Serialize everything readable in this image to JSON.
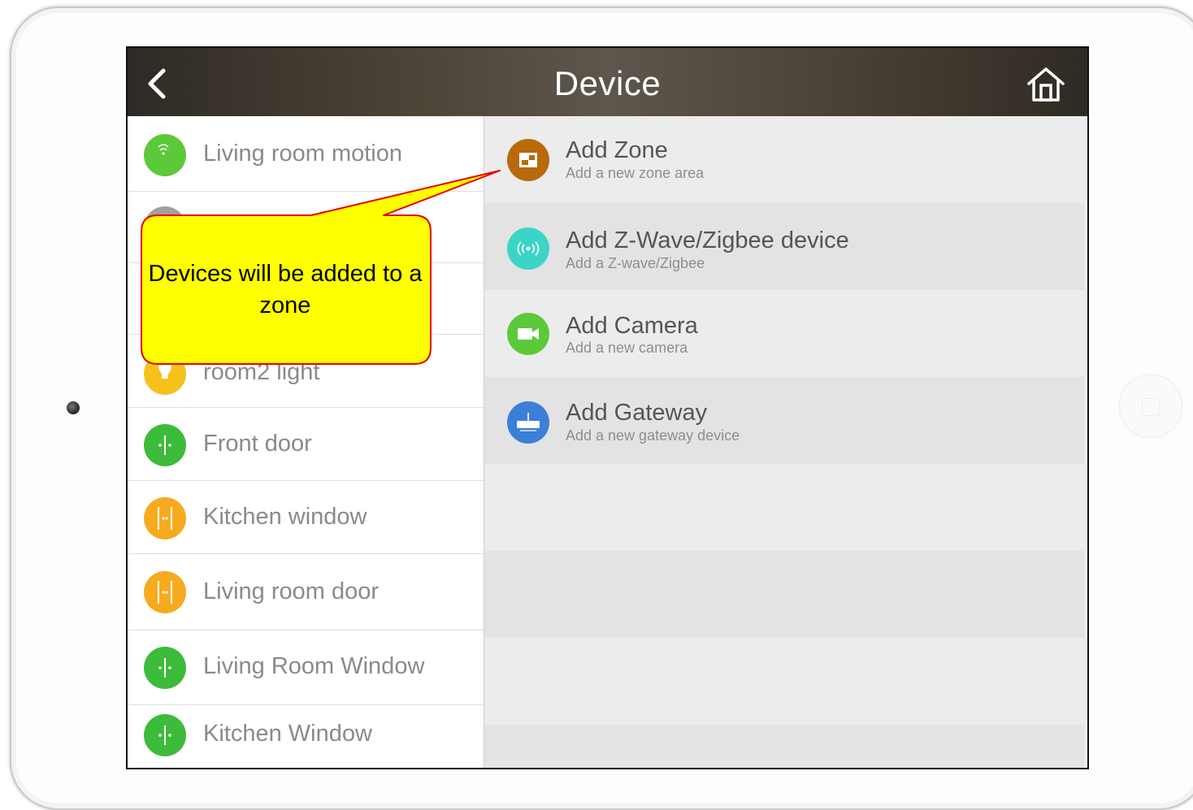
{
  "header": {
    "title": "Device",
    "back_icon": "chevron-left-icon",
    "home_icon": "home-icon"
  },
  "device_list": [
    {
      "label": "Living room motion",
      "icon": "motion-sensor-icon",
      "color": "#5cc93a"
    },
    {
      "label": "",
      "icon": "device-icon",
      "color": "#a0a0a0"
    },
    {
      "label": "",
      "icon": "device-icon",
      "color": "#a0a0a0"
    },
    {
      "label": "room2 light",
      "icon": "bulb-icon",
      "color": "#f5c21b"
    },
    {
      "label": "Front door",
      "icon": "door-sensor-icon",
      "color": "#3dbb3a"
    },
    {
      "label": "Kitchen window",
      "icon": "window-sensor-icon",
      "color": "#f6aa1f"
    },
    {
      "label": "Living room door",
      "icon": "door-sensor-icon",
      "color": "#f6aa1f"
    },
    {
      "label": "Living Room Window",
      "icon": "window-sensor-icon",
      "color": "#3dbb3a"
    },
    {
      "label": "Kitchen Window",
      "icon": "window-sensor-icon",
      "color": "#3dbb3a"
    }
  ],
  "actions": [
    {
      "title": "Add Zone",
      "subtitle": "Add a new zone area",
      "icon": "zone-icon",
      "color": "#b86a0a"
    },
    {
      "title": "Add Z-Wave/Zigbee device",
      "subtitle": "Add a Z-wave/Zigbee",
      "icon": "wireless-icon",
      "color": "#3dd4c8"
    },
    {
      "title": "Add Camera",
      "subtitle": "Add a new camera",
      "icon": "camera-icon",
      "color": "#5cc93a"
    },
    {
      "title": "Add Gateway",
      "subtitle": "Add a new gateway device",
      "icon": "gateway-icon",
      "color": "#3b7fd8"
    }
  ],
  "callout": {
    "text": "Devices will be added to a zone",
    "fill": "#ffff00",
    "border": "#e60000"
  }
}
